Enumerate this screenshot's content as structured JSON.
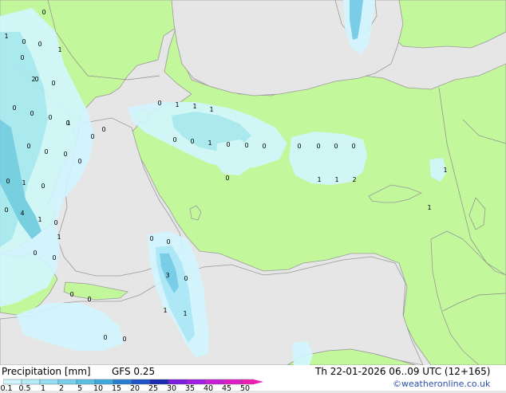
{
  "title": "Precipitation [mm]",
  "model": "GFS 0.25",
  "valid_time": "Th 22-01-2026 06..09 UTC (12+165)",
  "credit": "©weatheronline.co.uk",
  "colors": {
    "sea": "#e6e6e6",
    "land": "#c3f79b",
    "border": "#8c8c8c",
    "coast": "#9a9a9a",
    "precip_light": "#d2f6ff",
    "precip_mid": "#a8e8f7",
    "precip_heavy": "#6fcbe8"
  },
  "legend": {
    "scale": [
      {
        "label": "0.1",
        "color": "#d2f6ff"
      },
      {
        "label": "0.5",
        "color": "#b4ebf9"
      },
      {
        "label": "1",
        "color": "#96def3"
      },
      {
        "label": "2",
        "color": "#78d0ec"
      },
      {
        "label": "5",
        "color": "#5ac0e4"
      },
      {
        "label": "10",
        "color": "#3ca8dc"
      },
      {
        "label": "15",
        "color": "#2a7ed2"
      },
      {
        "label": "20",
        "color": "#1e54c8"
      },
      {
        "label": "25",
        "color": "#1a2cb4"
      },
      {
        "label": "30",
        "color": "#7a1ee0"
      },
      {
        "label": "35",
        "color": "#a01ee6"
      },
      {
        "label": "40",
        "color": "#c81ed8"
      },
      {
        "label": "45",
        "color": "#e01ec8"
      },
      {
        "label": "50",
        "color": "#f01eb4"
      }
    ]
  },
  "point_values": [
    {
      "v": "0"
    },
    {
      "v": "1"
    },
    {
      "v": "0"
    },
    {
      "v": "0"
    },
    {
      "v": "1"
    },
    {
      "v": "0"
    },
    {
      "v": "0"
    },
    {
      "v": "0"
    },
    {
      "v": "2"
    },
    {
      "v": "0"
    },
    {
      "v": "0"
    },
    {
      "v": "0"
    },
    {
      "v": "0"
    },
    {
      "v": "1"
    },
    {
      "v": "0"
    },
    {
      "v": "0"
    },
    {
      "v": "0"
    },
    {
      "v": "0"
    },
    {
      "v": "0"
    },
    {
      "v": "0"
    },
    {
      "v": "0"
    },
    {
      "v": "1"
    },
    {
      "v": "1"
    },
    {
      "v": "1"
    },
    {
      "v": "0"
    },
    {
      "v": "0"
    },
    {
      "v": "1"
    },
    {
      "v": "0"
    },
    {
      "v": "0"
    },
    {
      "v": "0"
    },
    {
      "v": "0"
    },
    {
      "v": "0"
    },
    {
      "v": "0"
    },
    {
      "v": "0"
    },
    {
      "v": "0"
    },
    {
      "v": "1"
    },
    {
      "v": "1"
    },
    {
      "v": "2"
    },
    {
      "v": "1"
    },
    {
      "v": "1"
    },
    {
      "v": "0"
    },
    {
      "v": "1"
    },
    {
      "v": "0"
    },
    {
      "v": "0"
    },
    {
      "v": "4"
    },
    {
      "v": "1"
    },
    {
      "v": "0"
    },
    {
      "v": "1"
    },
    {
      "v": "0"
    },
    {
      "v": "0"
    },
    {
      "v": "0"
    },
    {
      "v": "0"
    },
    {
      "v": "0"
    },
    {
      "v": "0"
    },
    {
      "v": "3"
    },
    {
      "v": "0"
    },
    {
      "v": "1"
    },
    {
      "v": "1"
    },
    {
      "v": "0"
    },
    {
      "v": "0"
    }
  ]
}
